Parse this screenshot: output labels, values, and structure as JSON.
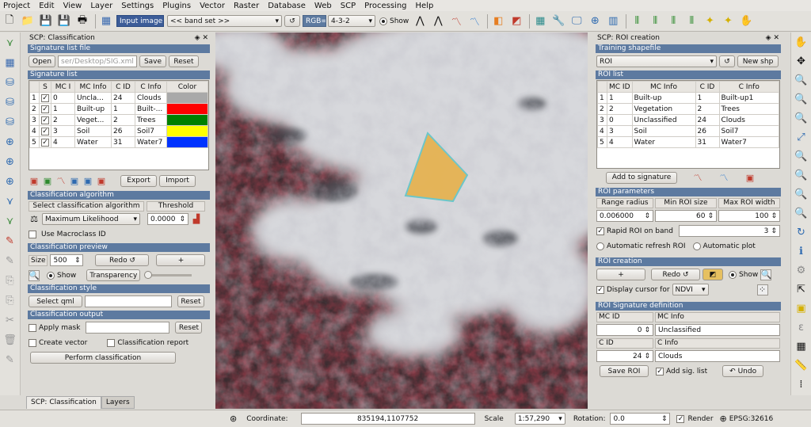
{
  "menubar": [
    "Project",
    "Edit",
    "View",
    "Layer",
    "Settings",
    "Plugins",
    "Vector",
    "Raster",
    "Database",
    "Web",
    "SCP",
    "Processing",
    "Help"
  ],
  "toolbar": {
    "input_image_label": "Input image",
    "band_set": "<< band set >>",
    "rgb_label": "RGB=",
    "rgb_value": "4-3-2",
    "show_label": "Show"
  },
  "left_panel": {
    "title": "SCP: Classification",
    "signature_file_section": "Signature list file",
    "open_button": "Open",
    "file_path": "ser/Desktop/SIG.xml",
    "save_button": "Save",
    "reset_button": "Reset",
    "signature_list_section": "Signature list",
    "columns": [
      "S",
      "MC I",
      "MC Info",
      "C ID",
      "C Info",
      "Color"
    ],
    "rows": [
      {
        "n": "1",
        "mcid": "0",
        "mcinfo": "Uncla...",
        "cid": "24",
        "cinfo": "Clouds",
        "color": "#a9a9a9"
      },
      {
        "n": "2",
        "mcid": "1",
        "mcinfo": "Built-up",
        "cid": "1",
        "cinfo": "Built-...",
        "color": "#ff0000"
      },
      {
        "n": "3",
        "mcid": "2",
        "mcinfo": "Veget...",
        "cid": "2",
        "cinfo": "Trees",
        "color": "#008000"
      },
      {
        "n": "4",
        "mcid": "3",
        "mcinfo": "Soil",
        "cid": "26",
        "cinfo": "Soil7",
        "color": "#ffff00"
      },
      {
        "n": "5",
        "mcid": "4",
        "mcinfo": "Water",
        "cid": "31",
        "cinfo": "Water7",
        "color": "#0033ff"
      }
    ],
    "export_button": "Export",
    "import_button": "Import",
    "algorithm_section": "Classification algorithm",
    "select_algorithm_label": "Select classification algorithm",
    "threshold_label": "Threshold",
    "algorithm_value": "Maximum Likelihood",
    "threshold_value": "0.0000",
    "macroclass_label": "Use Macroclass ID",
    "preview_section": "Classification preview",
    "size_label": "Size",
    "size_value": "500",
    "redo_button": "Redo ↺",
    "plus_button": "+",
    "show_label": "Show",
    "transparency_button": "Transparency",
    "style_section": "Classification style",
    "select_qml_button": "Select qml",
    "style_reset_button": "Reset",
    "output_section": "Classification output",
    "apply_mask_label": "Apply mask",
    "mask_reset_button": "Reset",
    "create_vector_label": "Create vector",
    "classification_report_label": "Classification report",
    "perform_button": "Perform classification",
    "tab_classification": "SCP: Classification",
    "tab_layers": "Layers"
  },
  "right_panel": {
    "title": "SCP: ROI creation",
    "training_section": "Training shapefile",
    "training_value": "ROI",
    "new_shp_button": "New shp",
    "roi_list_section": "ROI list",
    "columns": [
      "MC ID",
      "MC Info",
      "C ID",
      "C Info"
    ],
    "rows": [
      {
        "n": "1",
        "mcid": "1",
        "mcinfo": "Built-up",
        "cid": "1",
        "cinfo": "Built-up1"
      },
      {
        "n": "2",
        "mcid": "2",
        "mcinfo": "Vegetation",
        "cid": "2",
        "cinfo": "Trees"
      },
      {
        "n": "3",
        "mcid": "0",
        "mcinfo": "Unclassified",
        "cid": "24",
        "cinfo": "Clouds"
      },
      {
        "n": "4",
        "mcid": "3",
        "mcinfo": "Soil",
        "cid": "26",
        "cinfo": "Soil7"
      },
      {
        "n": "5",
        "mcid": "4",
        "mcinfo": "Water",
        "cid": "31",
        "cinfo": "Water7"
      }
    ],
    "add_to_signature_button": "Add to signature",
    "params_section": "ROI parameters",
    "range_radius_label": "Range radius",
    "min_roi_label": "Min ROI size",
    "max_roi_label": "Max ROI width",
    "range_radius_value": "0.006000",
    "min_roi_value": "60",
    "max_roi_value": "100",
    "rapid_roi_label": "Rapid ROI on band",
    "rapid_roi_value": "3",
    "auto_refresh_label": "Automatic refresh ROI",
    "auto_plot_label": "Automatic  plot",
    "creation_section": "ROI creation",
    "plus_button": "+",
    "redo_button": "Redo ↺",
    "show_label": "Show",
    "display_cursor_label": "Display cursor for",
    "display_cursor_value": "NDVI",
    "sig_def_section": "ROI Signature definition",
    "mc_id_label": "MC ID",
    "mc_info_label": "MC Info",
    "mc_id_value": "0",
    "mc_info_value": "Unclassified",
    "c_id_label": "C ID",
    "c_info_label": "C Info",
    "c_id_value": "24",
    "c_info_value": "Clouds",
    "save_roi_button": "Save ROI",
    "add_sig_list_label": "Add sig. list",
    "undo_button": "↶ Undo"
  },
  "statusbar": {
    "coordinate_label": "Coordinate:",
    "coordinate_value": "835194,1107752",
    "scale_label": "Scale",
    "scale_value": "1:57,290",
    "rotation_label": "Rotation:",
    "rotation_value": "0.0",
    "render_label": "Render",
    "crs_label": "EPSG:32616"
  }
}
